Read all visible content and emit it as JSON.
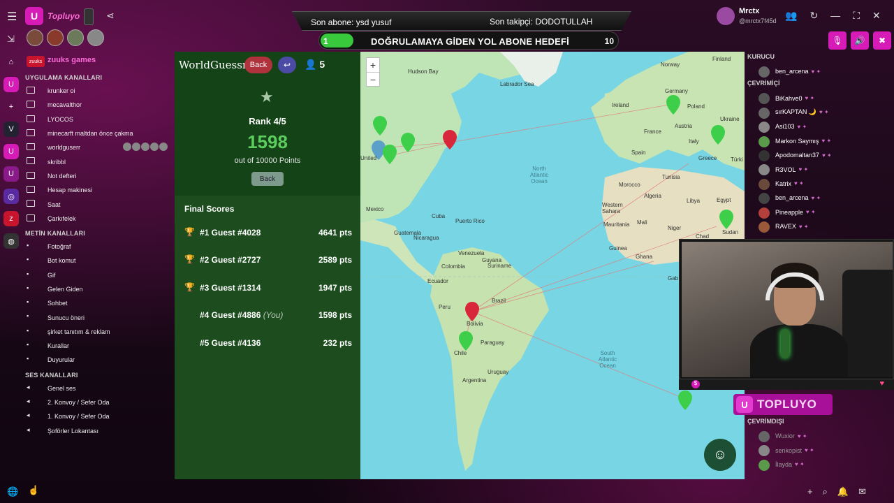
{
  "app": {
    "brand_name": "Topluyo",
    "user_name": "Mrctx",
    "user_handle": "@mrctx7f45d"
  },
  "ticker": {
    "last_sub": "Son abone: ysd yusuf",
    "last_follower": "Son takipçi: DODOTULLAH"
  },
  "goal": {
    "start": "1",
    "label": "DOĞRULAMAYA GİDEN YOL ABONE HEDEFİ",
    "end": "10",
    "progress_fraction": 0.11
  },
  "sidebar": {
    "server_name": "zuuks games",
    "section_app": "UYGULAMA KANALLARI",
    "app_channels": [
      "krunker oi",
      "mecavalthor",
      "LYOCOS",
      "minecarft maltdan önce çakma",
      "worldguserr",
      "skribbl",
      "Not defteri",
      "Hesap makinesi",
      "Saat",
      "Çarkıfelek"
    ],
    "section_text": "METİN KANALLARI",
    "text_channels": [
      "Fotoğraf",
      "Bot komut",
      "Gif",
      "Gelen Giden",
      "Sohbet",
      "Sunucu öneri",
      "şirket tanıtım & reklam",
      "Kurallar",
      "Duyurular"
    ],
    "section_voice": "SES KANALLARI",
    "voice_channels": [
      "Genel ses",
      "2. Konvoy / Sefer Oda",
      "1. Konvoy / Sefer Oda",
      "Şoförler Lokantası"
    ]
  },
  "game": {
    "title": "WorldGuessr",
    "back_label": "Back",
    "return_icon": "↩",
    "player_count": "5",
    "rank": "Rank 4/5",
    "score": "1598",
    "score_sub": "out of 10000 Points",
    "back_small": "Back",
    "final_title": "Final Scores",
    "scores": [
      {
        "name": "#1 Guest #4028",
        "you": "",
        "pts": "4641 pts",
        "trophy": "gold"
      },
      {
        "name": "#2 Guest #2727",
        "you": "",
        "pts": "2589 pts",
        "trophy": "silver"
      },
      {
        "name": "#3 Guest #1314",
        "you": "",
        "pts": "1947 pts",
        "trophy": "bronze"
      },
      {
        "name": "#4 Guest #4886",
        "you": "(You)",
        "pts": "1598 pts",
        "trophy": ""
      },
      {
        "name": "#5 Guest #4136",
        "you": "",
        "pts": "232 pts",
        "trophy": ""
      }
    ]
  },
  "map": {
    "zoom_in": "+",
    "zoom_out": "−",
    "labels": {
      "hudson_bay": "Hudson Bay",
      "labrador": "Labrador Sea",
      "norway": "Norway",
      "finland": "Finland",
      "ireland": "Ireland",
      "poland": "Poland",
      "ukraine": "Ukraine",
      "germany": "Germany",
      "france": "France",
      "austria": "Austria",
      "spain": "Spain",
      "italy": "Italy",
      "greece": "Greece",
      "turkey": "Türki",
      "united": "United",
      "mexico": "Mexico",
      "cuba": "Cuba",
      "puerto_rico": "Puerto Rico",
      "guatemala": "Guatemala",
      "nicaragua": "Nicaragua",
      "venezuela": "Venezuela",
      "guyana": "Guyana",
      "suriname": "Suriname",
      "colombia": "Colombia",
      "ecuador": "Ecuador",
      "peru": "Peru",
      "brazil": "Brazil",
      "bolivia": "Bolivia",
      "paraguay": "Paraguay",
      "chile": "Chile",
      "uruguay": "Uruguay",
      "argentina": "Argentina",
      "morocco": "Morocco",
      "tunisia": "Tunisia",
      "algeria": "Algeria",
      "libya": "Libya",
      "egypt": "Egypt",
      "western_sahara": "Western Sahara",
      "mauritania": "Mauritania",
      "mali": "Mali",
      "niger": "Niger",
      "chad": "Chad",
      "sudan": "Sudan",
      "guinea": "Guinea",
      "ghana": "Ghana",
      "gab": "Gab",
      "n_atlantic": "North Atlantic Ocean",
      "s_atlantic": "South Atlantic Ocean"
    },
    "emoji_icon": "☺"
  },
  "members": {
    "section_founder": "KURUCU",
    "founder": [
      "ben_arcena"
    ],
    "section_online": "ÇEVRİMİÇİ",
    "online": [
      "BiKahve0",
      "sırKAPTAN 🌙",
      "Asi103",
      "Markon Saymış",
      "Apodomaltan37",
      "R3VOL",
      "Katrix",
      "ben_arcena",
      "Pineapple",
      "RAVEX"
    ],
    "section_offline": "ÇEVRİMDIŞI",
    "offline": [
      "Wuxior",
      "senkopist",
      "İlayda"
    ]
  },
  "overlay": {
    "banner": "TOPLUYO"
  },
  "colors": {
    "accent": "#d61bb6",
    "game_panel": "#1d4d1f",
    "score_green": "#5ccd5e",
    "map_water": "#78d6e4"
  }
}
